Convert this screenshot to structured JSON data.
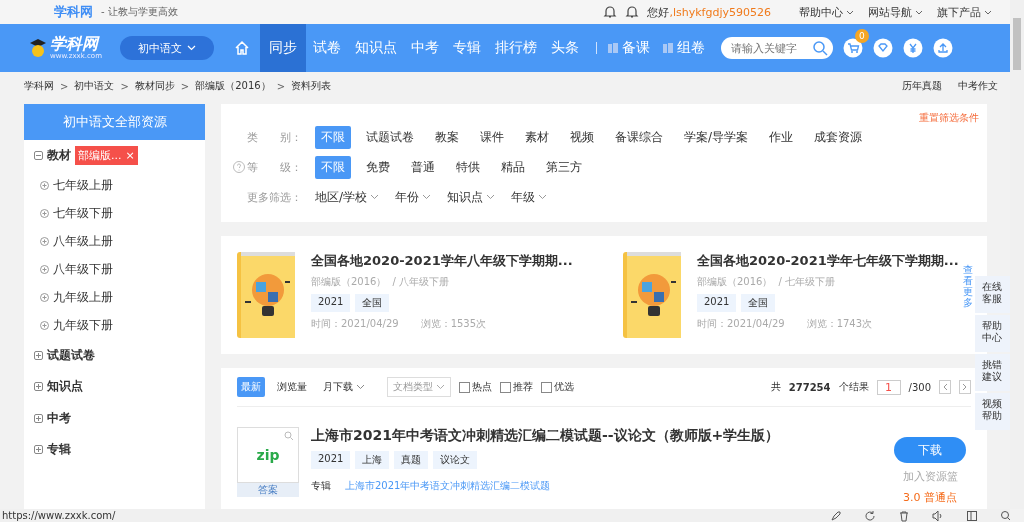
{
  "header": {
    "site": "学科网",
    "slogan": "- 让教与学更高效",
    "greeting": "您好",
    "username": ",lshykfgdjy590526",
    "links": [
      "帮助中心",
      "网站导航",
      "旗下产品"
    ]
  },
  "nav": {
    "logo": "学科网",
    "logo_sub": "www.zxxk.com",
    "subject": "初中语文",
    "items": [
      {
        "label": "同步",
        "selected": true
      },
      {
        "label": "试卷",
        "selected": false
      },
      {
        "label": "知识点",
        "selected": false
      },
      {
        "label": "中考",
        "selected": false
      },
      {
        "label": "专辑",
        "selected": false
      },
      {
        "label": "排行榜",
        "selected": false
      },
      {
        "label": "头条",
        "selected": false
      }
    ],
    "tools": [
      "备课",
      "组卷"
    ],
    "search": {
      "placeholder": "请输入关键字"
    },
    "cart_count": "0"
  },
  "breadcrumb": [
    "学科网",
    "初中语文",
    "教材同步",
    "部编版（2016）",
    "资料列表"
  ],
  "breadcrumb_separator": ">",
  "breadcrumb_links": [
    "历年真题",
    "中考作文"
  ],
  "sidebar": {
    "title": "初中语文全部资源",
    "tree": [
      {
        "label": "教材",
        "expanded": true,
        "tag": "部编版...",
        "tag_close": "×",
        "children": [
          {
            "label": "七年级上册"
          },
          {
            "label": "七年级下册"
          },
          {
            "label": "八年级上册"
          },
          {
            "label": "八年级下册"
          },
          {
            "label": "九年级上册"
          },
          {
            "label": "九年级下册"
          }
        ]
      },
      {
        "label": "试题试卷",
        "expanded": false
      },
      {
        "label": "知识点",
        "expanded": false
      },
      {
        "label": "中考",
        "expanded": false
      },
      {
        "label": "专辑",
        "expanded": false
      }
    ]
  },
  "filters": {
    "reset": "重置筛选条件",
    "rows": [
      {
        "label": "类　　别：",
        "help": false,
        "options": [
          {
            "label": "不限",
            "selected": true
          },
          {
            "label": "试题试卷",
            "selected": false
          },
          {
            "label": "教案",
            "selected": false
          },
          {
            "label": "课件",
            "selected": false
          },
          {
            "label": "素材",
            "selected": false
          },
          {
            "label": "视频",
            "selected": false
          },
          {
            "label": "备课综合",
            "selected": false
          },
          {
            "label": "学案/导学案",
            "selected": false
          },
          {
            "label": "作业",
            "selected": false
          },
          {
            "label": "成套资源",
            "selected": false
          }
        ]
      },
      {
        "label": "等　　级：",
        "help": true,
        "options": [
          {
            "label": "不限",
            "selected": true
          },
          {
            "label": "免费",
            "selected": false
          },
          {
            "label": "普通",
            "selected": false
          },
          {
            "label": "特供",
            "selected": false
          },
          {
            "label": "精品",
            "selected": false
          },
          {
            "label": "第三方",
            "selected": false
          }
        ]
      }
    ],
    "more_label": "更多筛选：",
    "dropdowns": [
      "地区/学校",
      "年份",
      "知识点",
      "年级"
    ]
  },
  "featured": [
    {
      "title": "全国各地2020-2021学年八年级下学期期...",
      "edition": "部编版（2016）",
      "volume": "/ 八年级下册",
      "tags": [
        "2021",
        "全国"
      ],
      "time": "时间：2021/04/29",
      "views": "浏览：1535次"
    },
    {
      "title": "全国各地2020-2021学年七年级下学期期...",
      "edition": "部编版（2016）",
      "volume": "/ 七年级下册",
      "tags": [
        "2021",
        "全国"
      ],
      "time": "时间：2021/04/29",
      "views": "浏览：1743次"
    }
  ],
  "featured_more": "查看更多",
  "list": {
    "sorts": [
      {
        "label": "最新",
        "selected": true,
        "caret": false
      },
      {
        "label": "浏览量",
        "selected": false,
        "caret": false
      },
      {
        "label": "月下载",
        "selected": false,
        "caret": true
      }
    ],
    "doc_type": "文档类型",
    "checks": [
      {
        "label": "热点",
        "checked": false
      },
      {
        "label": "推荐",
        "checked": false
      },
      {
        "label": "优选",
        "checked": false
      }
    ],
    "total_prefix": "共",
    "total": "277254",
    "total_suffix": "个结果",
    "page": "1",
    "pages": "/300",
    "items": [
      {
        "title": "上海市2021年中考语文冲刺精选汇编二模试题--议论文（教师版+学生版）",
        "file_type": "zip",
        "badge": "答案",
        "tags": [
          "2021",
          "上海",
          "真题",
          "议论文"
        ],
        "album_label": "专辑",
        "album": "上海市2021年中考语文冲刺精选汇编二模试题",
        "download": "下载",
        "add": "加入资源篮",
        "price": "3.0 普通点"
      }
    ]
  },
  "float_help": [
    "在线客服",
    "帮助中心",
    "挑错建议",
    "视频帮助"
  ],
  "status_url": "https://www.zxxk.com/"
}
